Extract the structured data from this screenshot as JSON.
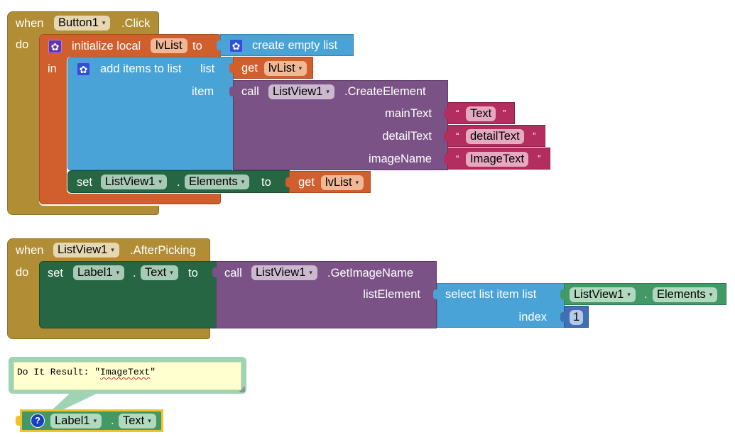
{
  "colors": {
    "event": "#b18e35",
    "variable": "#d05f2d",
    "list": "#4aa3d6",
    "component_method": "#7b5286",
    "setter": "#266643",
    "getter": "#439966",
    "text": "#b32d5e",
    "math": "#3f6fb5",
    "selected_outline": "#f3c22a"
  },
  "block1": {
    "when": "when",
    "component": "Button1",
    "event": ".Click",
    "do": "do",
    "init_local": {
      "label": "initialize local",
      "var_name": "lvList",
      "to": "to",
      "in": "in",
      "value_label": "create empty list"
    },
    "add_items": {
      "label": "add items to list",
      "list_label": "list",
      "item_label": "item",
      "get_label": "get",
      "get_var": "lvList"
    },
    "create_element": {
      "call": "call",
      "component": "ListView1",
      "method": ".CreateElement",
      "params": [
        {
          "name": "mainText",
          "value": "Text"
        },
        {
          "name": "detailText",
          "value": "detailText"
        },
        {
          "name": "imageName",
          "value": "ImageText"
        }
      ]
    },
    "set_elements": {
      "set": "set",
      "component": "ListView1",
      "dot": ".",
      "property": "Elements",
      "to": "to",
      "get_label": "get",
      "get_var": "lvList"
    }
  },
  "block2": {
    "when": "when",
    "component": "ListView1",
    "event": ".AfterPicking",
    "do": "do",
    "set": "set",
    "target_component": "Label1",
    "dot": ".",
    "target_property": "Text",
    "to": "to",
    "call": "call",
    "call_component": "ListView1",
    "call_method": ".GetImageName",
    "param_label": "listElement",
    "select": {
      "label": "select list item  list",
      "index_label": "index",
      "list_component": "ListView1",
      "dot": ".",
      "list_property": "Elements",
      "index_value": "1"
    }
  },
  "result": {
    "prefix": "Do It Result: \"",
    "value": "ImageText",
    "suffix": "\"",
    "block_component": "Label1",
    "block_dot": ".",
    "block_property": "Text",
    "help_icon": "?"
  },
  "quote_open": "“",
  "quote_close": "”",
  "dropdown_arrow": "▾"
}
